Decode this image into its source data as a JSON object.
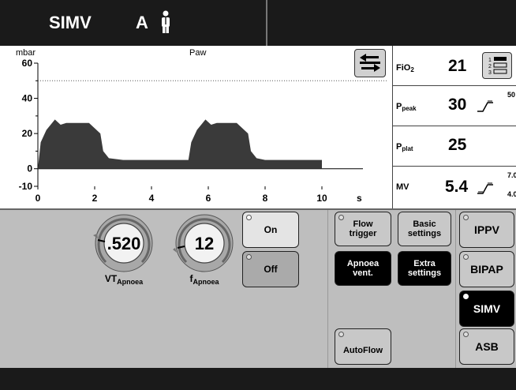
{
  "header": {
    "mode": "SIMV",
    "patient_type": "A"
  },
  "graph": {
    "unit": "mbar",
    "title": "Paw",
    "y_ticks": [
      "60",
      "40",
      "20",
      "0",
      "-10"
    ],
    "x_ticks": [
      "0",
      "2",
      "4",
      "6",
      "8",
      "10"
    ],
    "x_unit": "s"
  },
  "chart_data": {
    "type": "area",
    "title": "Paw",
    "xlabel": "s",
    "ylabel": "mbar",
    "xlim": [
      0,
      12
    ],
    "ylim": [
      -10,
      60
    ],
    "alarm_limit": 50,
    "x": [
      0,
      0.1,
      0.3,
      0.6,
      0.8,
      1.0,
      1.3,
      1.8,
      2.2,
      2.3,
      2.5,
      3.0,
      4.0,
      5.0,
      5.3,
      5.4,
      5.6,
      5.9,
      6.1,
      6.3,
      6.6,
      7.0,
      7.4,
      7.5,
      7.7,
      8.0,
      9.0,
      10.0
    ],
    "y": [
      0,
      15,
      22,
      28,
      25,
      26,
      26,
      26,
      20,
      10,
      6,
      5,
      5,
      5,
      5,
      15,
      22,
      28,
      25,
      26,
      26,
      26,
      20,
      10,
      6,
      5,
      5,
      5
    ]
  },
  "values": [
    {
      "label": "FiO",
      "sub": "2",
      "value": "21",
      "sup": ""
    },
    {
      "label": "P",
      "sub": "peak",
      "value": "30",
      "sup": "50"
    },
    {
      "label": "P",
      "sub": "plat",
      "value": "25",
      "sup": ""
    },
    {
      "label": "MV",
      "sub": "",
      "value": "5.4",
      "sup": "7.0",
      "sup2": "4.0"
    }
  ],
  "knobs": [
    {
      "value": ".520",
      "label": "VT",
      "sub": "Apnoea"
    },
    {
      "value": "12",
      "label": "f",
      "sub": "Apnoea"
    }
  ],
  "buttons": {
    "on": "On",
    "off": "Off",
    "flow_trigger_1": "Flow",
    "flow_trigger_2": "trigger",
    "apnoea_1": "Apnoea",
    "apnoea_2": "vent.",
    "basic_1": "Basic",
    "basic_2": "settings",
    "extra_1": "Extra",
    "extra_2": "settings",
    "autoflow": "AutoFlow",
    "ippv": "IPPV",
    "bipap": "BIPAP",
    "simv": "SIMV",
    "asb": "ASB"
  }
}
